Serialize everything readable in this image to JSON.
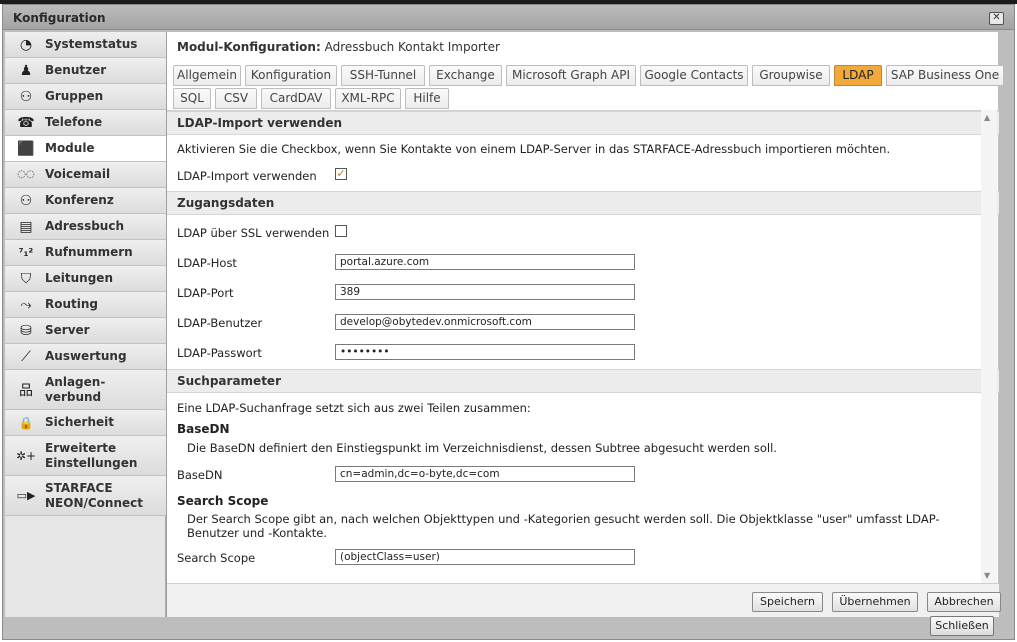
{
  "window": {
    "title": "Konfiguration",
    "close_glyph": "✕"
  },
  "sidebar": {
    "items": [
      {
        "label": "Systemstatus",
        "icon": "◔",
        "icon_name": "clock-icon"
      },
      {
        "label": "Benutzer",
        "icon": "♟",
        "icon_name": "user-icon"
      },
      {
        "label": "Gruppen",
        "icon": "⚇",
        "icon_name": "group-icon"
      },
      {
        "label": "Telefone",
        "icon": "☎",
        "icon_name": "phone-icon"
      },
      {
        "label": "Module",
        "icon": "⬛",
        "icon_name": "module-icon"
      },
      {
        "label": "Voicemail",
        "icon": "◌◌",
        "icon_name": "voicemail-icon"
      },
      {
        "label": "Konferenz",
        "icon": "⚇",
        "icon_name": "conference-icon"
      },
      {
        "label": "Adressbuch",
        "icon": "▤",
        "icon_name": "addressbook-icon"
      },
      {
        "label": "Rufnummern",
        "icon": "⁷₁²",
        "icon_name": "numbers-icon"
      },
      {
        "label": "Leitungen",
        "icon": "⛉",
        "icon_name": "lines-icon"
      },
      {
        "label": "Routing",
        "icon": "⤳",
        "icon_name": "routing-icon"
      },
      {
        "label": "Server",
        "icon": "⛁",
        "icon_name": "server-icon"
      },
      {
        "label": "Auswertung",
        "icon": "⟋",
        "icon_name": "chart-icon"
      },
      {
        "label": "Anlagen-\nverbund",
        "icon": "品",
        "icon_name": "network-icon"
      },
      {
        "label": "Sicherheit",
        "icon": "🔒",
        "icon_name": "lock-icon"
      },
      {
        "label": "Erweiterte\nEinstellungen",
        "icon": "✲+",
        "icon_name": "advanced-settings-icon"
      },
      {
        "label": "STARFACE\nNEON/Connect",
        "icon": "▭▶",
        "icon_name": "camera-icon"
      }
    ]
  },
  "main": {
    "heading_bold": "Modul-Konfiguration:",
    "heading_rest": "Adressbuch Kontakt Importer",
    "tabs_row1": [
      "Allgemein",
      "Konfiguration",
      "SSH-Tunnel",
      "Exchange",
      "Microsoft Graph API",
      "Google Contacts",
      "Groupwise",
      "LDAP",
      "SAP Business One"
    ],
    "tabs_row2": [
      "SQL",
      "CSV",
      "CardDAV",
      "XML-RPC",
      "Hilfe"
    ],
    "section1": {
      "title": "LDAP-Import verwenden",
      "text": "Aktivieren Sie die Checkbox, wenn Sie Kontakte von einem LDAP-Server in das STARFACE-Adressbuch importieren möchten.",
      "checkbox_label": "LDAP-Import verwenden",
      "checkbox_glyph": "✓"
    },
    "section2": {
      "title": "Zugangsdaten",
      "ssl_label": "LDAP über SSL verwenden",
      "host_label": "LDAP-Host",
      "host_value": "portal.azure.com",
      "port_label": "LDAP-Port",
      "port_value": "389",
      "user_label": "LDAP-Benutzer",
      "user_value": "develop@obytedev.onmicrosoft.com",
      "pass_label": "LDAP-Passwort",
      "pass_value": "••••••••"
    },
    "section3": {
      "title": "Suchparameter",
      "intro": "Eine LDAP-Suchanfrage setzt sich aus zwei Teilen zusammen:",
      "basedn_heading": "BaseDN",
      "basedn_desc": "Die BaseDN definiert den Einstiegspunkt im Verzeichnisdienst, dessen Subtree abgesucht werden soll.",
      "basedn_label": "BaseDN",
      "basedn_value": "cn=admin,dc=o-byte,dc=com",
      "scope_heading": "Search Scope",
      "scope_desc": "Der Search Scope gibt an, nach welchen Objekttypen und -Kategorien gesucht werden soll. Die Objektklasse \"user\" umfasst LDAP-Benutzer und -Kontakte.",
      "scope_label": "Search Scope",
      "scope_value": "(objectClass=user)"
    },
    "buttons": {
      "save": "Speichern",
      "apply": "Übernehmen",
      "cancel": "Abbrechen"
    },
    "scroll_up": "▲",
    "scroll_down": "▼"
  },
  "close_button": "Schließen",
  "colors": {
    "active_tab": "#f2a93b",
    "active_nav": "#ffffff"
  }
}
